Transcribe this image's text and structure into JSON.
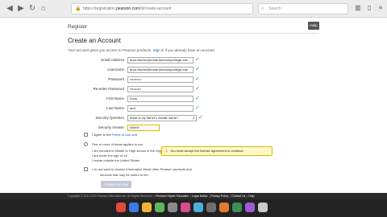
{
  "browser": {
    "url_prefix": "https://registration.",
    "url_domain": "pearson.com",
    "url_path": "/lti/create-account",
    "search_placeholder": "Search"
  },
  "header": {
    "breadcrumb": "Register",
    "help_label": "Help"
  },
  "page_title": "Create an Account",
  "intro": {
    "text_before": "Your account gives you access to Pearson products.",
    "link": "Sign in",
    "text_after": "if you already have an account."
  },
  "fields": [
    {
      "label": "Email Address",
      "value": "duck.fischer@email.kentuckycollege.edu",
      "valid": "✓"
    },
    {
      "label": "Username",
      "value": "duck.fischer@email.kentuckycollege.edu",
      "valid": "✓"
    },
    {
      "label": "Password",
      "value": "••••••••••",
      "valid": "✓"
    },
    {
      "label": "Re-enter Password",
      "value": "••••••••••",
      "valid": "✓"
    },
    {
      "label": "First Name",
      "value": "Duck",
      "valid": "✓"
    },
    {
      "label": "Last Name",
      "value": "and",
      "valid": "✓"
    }
  ],
  "security_question": {
    "label": "Security Question",
    "value": "What is my father's middle name?",
    "valid": "✓"
  },
  "security_answer": {
    "label": "Security Answer",
    "value": "Alfa%r"
  },
  "tooltip": {
    "text": "You must accept the license agreement to continue."
  },
  "agreements": {
    "terms_before": "I agree to the",
    "terms_link": "Terms of Use and",
    "one_or_more": "One or more of these applies to me:",
    "sub_options": [
      "I am enrolled in Middle or High school in the United States",
      "I am under the age of 18",
      "I reside outside the United States"
    ],
    "marketing": "I do not want to receive information about other Pearson products and",
    "marketing_cont": "services that may be useful to me."
  },
  "create_button": "Create Account",
  "footer": {
    "copyright": "Copyright © 2011-2020 Pearson Education Inc. All Rights Reserved.",
    "links": [
      "Pearson Higher Education",
      "Legal Notice",
      "Privacy Policy",
      "Contact Us",
      "Help"
    ]
  },
  "dock_colors": [
    "#e04b3a",
    "#3d7be0",
    "#f2b233",
    "#5bb85b",
    "#8a8a8a",
    "#d94c8e",
    "#4ab0d9",
    "#6e6e6e",
    "#e07a2d",
    "#3a8f58",
    "#9b5bd1",
    "#c9c9c9"
  ]
}
